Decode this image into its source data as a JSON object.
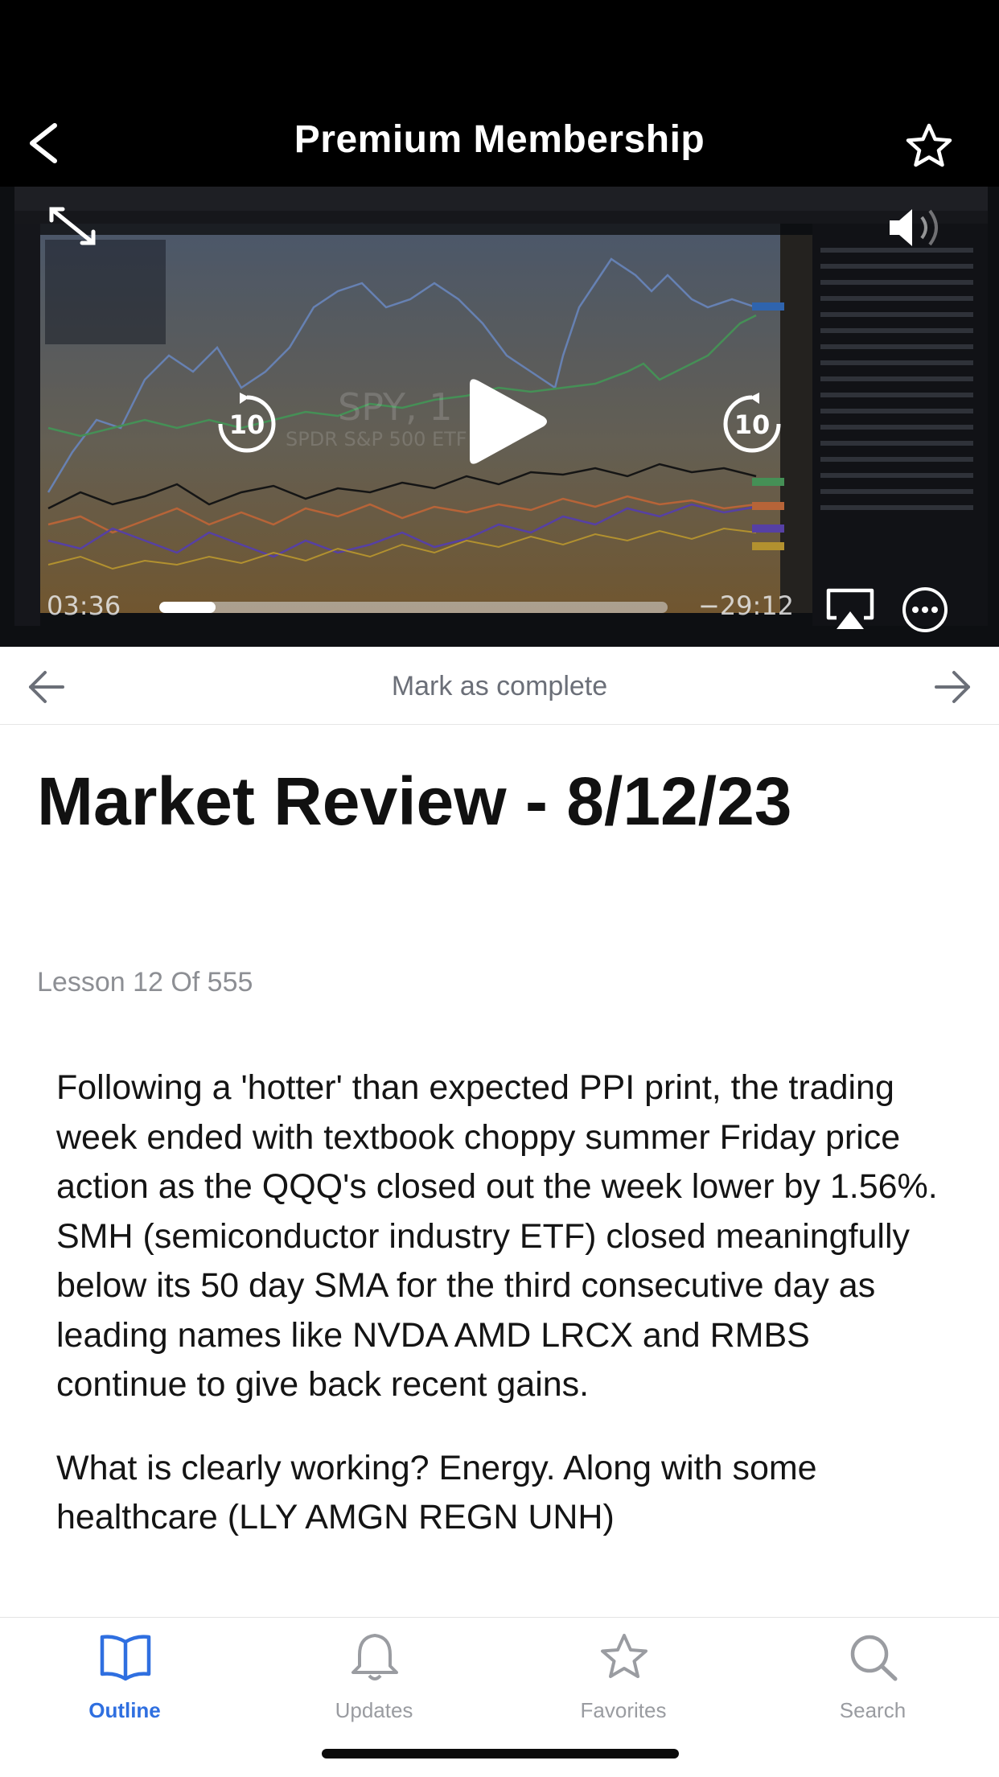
{
  "header": {
    "title": "Premium Membership"
  },
  "video": {
    "elapsed": "03:36",
    "remaining": "−29:12",
    "progress": 0.11,
    "skip_back_seconds": "10",
    "skip_forward_seconds": "10",
    "chart_symbol": "SPY, 1",
    "chart_subtitle": "SPDR S&P 500 ETF"
  },
  "lesson_nav": {
    "mark_complete": "Mark as complete"
  },
  "lesson": {
    "title": "Market Review - 8/12/23",
    "count": "Lesson 12 Of 555",
    "paragraphs": [
      "Following a 'hotter' than expected PPI print, the trading week ended with textbook choppy summer Friday price action as the QQQ's closed out the week lower by 1.56%. SMH (semiconductor industry ETF) closed meaningfully below its 50 day SMA for the third consecutive day as leading names like NVDA AMD LRCX and RMBS continue to give back recent gains.",
      "What is clearly working? Energy. Along with some healthcare (LLY AMGN REGN UNH)"
    ]
  },
  "tabbar": {
    "tabs": [
      {
        "label": "Outline",
        "icon": "book-icon",
        "active": true
      },
      {
        "label": "Updates",
        "icon": "bell-icon",
        "active": false
      },
      {
        "label": "Favorites",
        "icon": "star-icon",
        "active": false
      },
      {
        "label": "Search",
        "icon": "search-icon",
        "active": false
      }
    ]
  },
  "colors": {
    "accent": "#2f6fe0",
    "inactive": "#9a9ca1"
  }
}
